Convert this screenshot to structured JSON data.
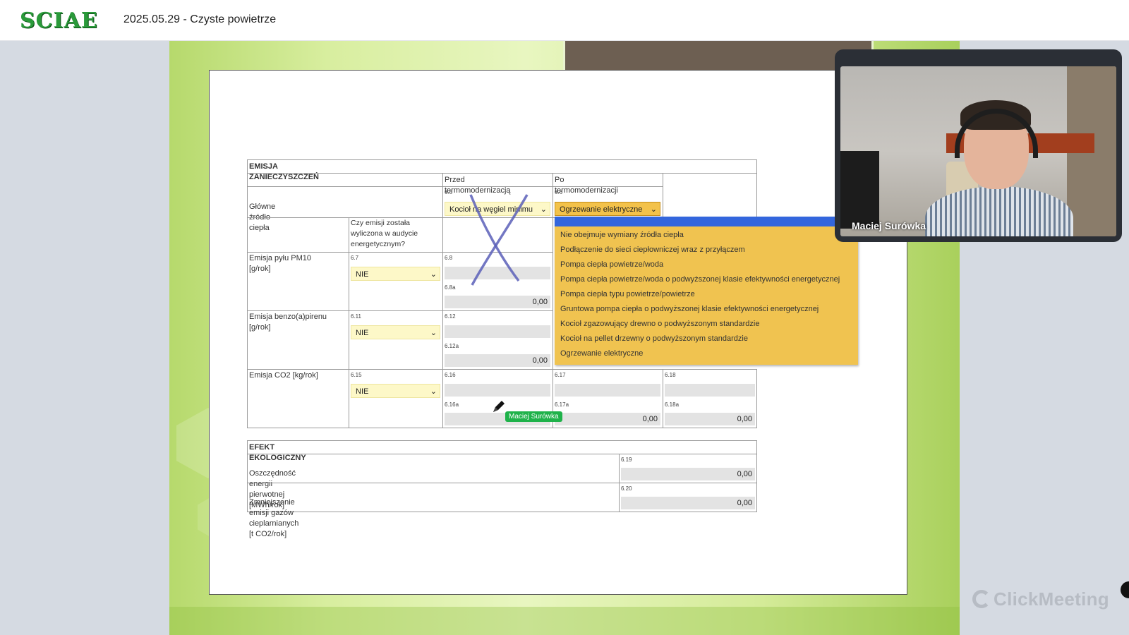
{
  "header": {
    "logo": "SCIAE",
    "meeting_title": "2025.05.29 - Czyste powietrze"
  },
  "form": {
    "section_title": "EMISJA ZANIECZYSZCZEŃ",
    "col_before": "Przed termomodernizacją",
    "col_after": "Po termomodernizacji",
    "main_source_label": "Główne źródło ciepła",
    "main_source_before": {
      "num": "6.5",
      "value": "Kocioł na węgiel minimu"
    },
    "main_source_after": {
      "num": "6.6",
      "value": "Ogrzewanie elektryczne"
    },
    "audit_question": "Czy emisji została wyliczona w audycie energetycznym?",
    "rows": [
      {
        "label": "Emisja pyłu PM10 [g/rok]",
        "sel_num": "6.7",
        "sel_value": "NIE",
        "f1": "6.8",
        "f2": "6.8a",
        "f2_value": "0,00"
      },
      {
        "label": "Emisja benzo(a)pirenu [g/rok]",
        "sel_num": "6.11",
        "sel_value": "NIE",
        "f1": "6.12",
        "f2": "6.12a",
        "f2_value": "0,00"
      },
      {
        "label": "Emisja CO2 [kg/rok]",
        "sel_num": "6.15",
        "sel_value": "NIE",
        "f1": "6.16",
        "f2": "6.16a",
        "f3": "6.17",
        "f3a": "6.17a",
        "f3a_value": "0,00",
        "f4": "6.18",
        "f4a": "6.18a",
        "f4a_value": "0,00"
      }
    ],
    "eco_title": "EFEKT EKOLOGICZNY",
    "eco_rows": [
      {
        "label": "Oszczędność energii pierwotnej [MWh/rok]",
        "num": "6.19",
        "value": "0,00"
      },
      {
        "label": "Zmniejszenie emisji gazów cieplarnianych [t CO2/rok]",
        "num": "6.20",
        "value": "0,00"
      }
    ]
  },
  "dropdown": {
    "options": [
      "Nie obejmuje wymiany źródła ciepła",
      "Podłączenie do sieci ciepłowniczej wraz z przyłączem",
      "Pompa ciepła powietrze/woda",
      "Pompa ciepła powietrze/woda o podwyższonej klasie efektywności energetycznej",
      "Pompa ciepła typu powietrze/powietrze",
      "Gruntowa pompa ciepła o podwyższonej klasie efektywności energetycznej",
      "Kocioł zgazowujący drewno o podwyższonym standardzie",
      "Kocioł na pellet drzewny o podwyższonym standardzie",
      "Ogrzewanie elektryczne"
    ]
  },
  "cursor_label": "Maciej Surówka",
  "webcam": {
    "participant_name": "Maciej Surówka"
  },
  "watermark": "ClickMeeting",
  "colors": {
    "accent_green": "#1fb24a",
    "dropdown_bg": "#f0c350",
    "dropdown_highlight": "#3366dd"
  }
}
